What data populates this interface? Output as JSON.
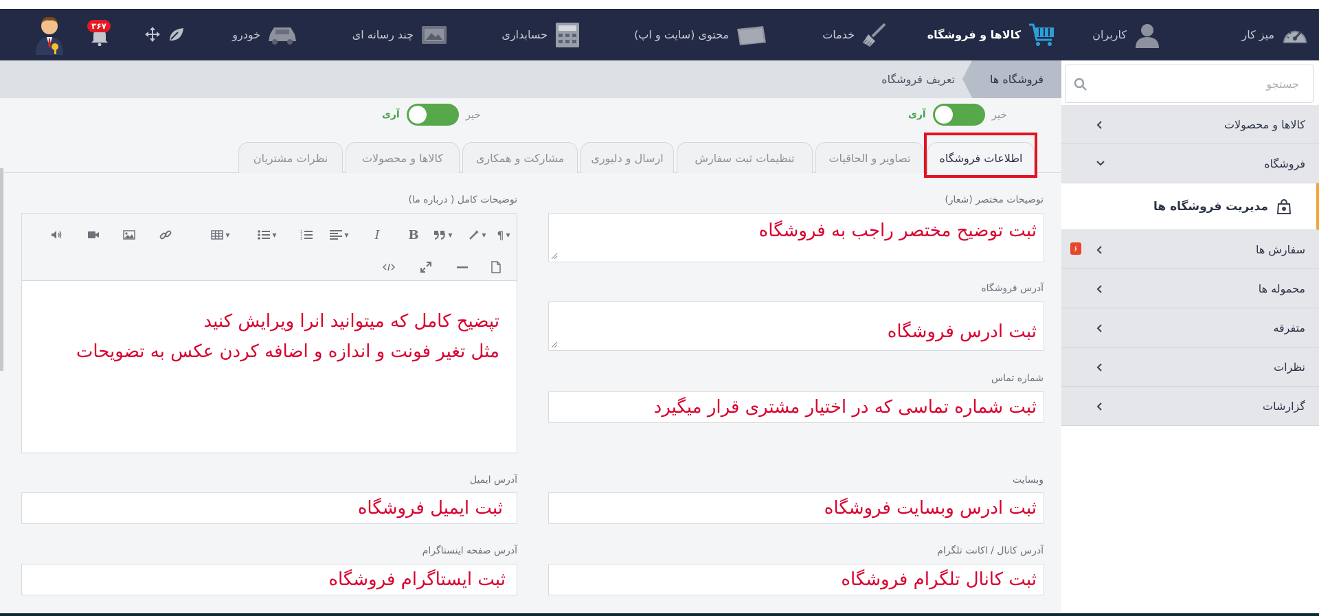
{
  "topnav": {
    "items": [
      {
        "label": "میز کار",
        "icon": "speedometer-icon"
      },
      {
        "label": "کاربران",
        "icon": "user-icon"
      },
      {
        "label": "کالاها و فروشگاه",
        "icon": "cart-icon"
      },
      {
        "label": "خدمات",
        "icon": "broom-icon"
      },
      {
        "label": "محتوی (سایت و اپ)",
        "icon": "folder-icon"
      },
      {
        "label": "حسابداری",
        "icon": "calculator-icon"
      },
      {
        "label": "چند رسانه ای",
        "icon": "media-icon"
      },
      {
        "label": "خودرو",
        "icon": "car-icon"
      }
    ],
    "notification_count": "۳۶۷",
    "colors": {
      "bar": "#232a45",
      "active_icon": "#2aa0d8"
    }
  },
  "breadcrumb": {
    "current": "فروشگاه ها",
    "page": "تعریف فروشگاه"
  },
  "sidebar": {
    "search_placeholder": "جستجو",
    "items": [
      {
        "label": "کالاها و محصولات"
      },
      {
        "label": "فروشگاه"
      },
      {
        "label": "مدیریت فروشگاه ها"
      },
      {
        "label": "سفارش ها",
        "badge": "۶"
      },
      {
        "label": "محموله ها"
      },
      {
        "label": "متفرقه"
      },
      {
        "label": "نظرات"
      },
      {
        "label": "گزارشات"
      }
    ]
  },
  "toggles": [
    {
      "no": "خیر",
      "yes": "آری",
      "value": true
    },
    {
      "no": "خیر",
      "yes": "آری",
      "value": true
    }
  ],
  "tabs": [
    {
      "label": "اطلاعات فروشگاه"
    },
    {
      "label": "تصاویر و الحاقیات"
    },
    {
      "label": "تنظیمات ثبت سفارش"
    },
    {
      "label": "ارسال و دلیوری"
    },
    {
      "label": "مشارکت و همکاری"
    },
    {
      "label": "کالاها و محصولات"
    },
    {
      "label": "نظرات مشتریان"
    }
  ],
  "form": {
    "short_desc": {
      "label": "توضیحات مختصر (شعار)",
      "value": "ثبت توضیح مختصر راجب به فروشگاه"
    },
    "address": {
      "label": "آدرس فروشگاه",
      "value": "ثبت ادرس فروشگاه"
    },
    "phone": {
      "label": "شماره تماس",
      "value": "ثبت شماره تماسی که در اختیار مشتری قرار میگیرد"
    },
    "website": {
      "label": "وبسایت",
      "value": "ثبت ادرس وبسایت فروشگاه"
    },
    "telegram": {
      "label": "آدرس کانال / اکانت تلگرام",
      "value": "ثبت کانال تلگرام فروشگاه"
    },
    "full_desc": {
      "label": "توضیحات کامل ( درباره ما)",
      "lines": [
        "تپضیح کامل که میتوانید انرا ویرایش کنید",
        "مثل تغیر فونت و اندازه و اضافه کردن عکس به تضویحات"
      ]
    },
    "email": {
      "label": "آدرس ایمیل",
      "value": "ثبت ایمیل فروشگاه"
    },
    "instagram": {
      "label": "آدرس صفحه اینستاگرام",
      "value": "ثبت ایستاگرام فروشگاه"
    }
  },
  "editor_toolbar": [
    "paragraph-icon",
    "magic-icon",
    "quote-icon",
    "bold-icon",
    "italic-icon",
    "align-icon",
    "ordered-list-icon",
    "unordered-list-icon",
    "table-icon",
    "link-icon",
    "image-icon",
    "video-icon",
    "audio-icon",
    "file-icon",
    "hr-icon",
    "fullscreen-icon",
    "code-icon"
  ]
}
